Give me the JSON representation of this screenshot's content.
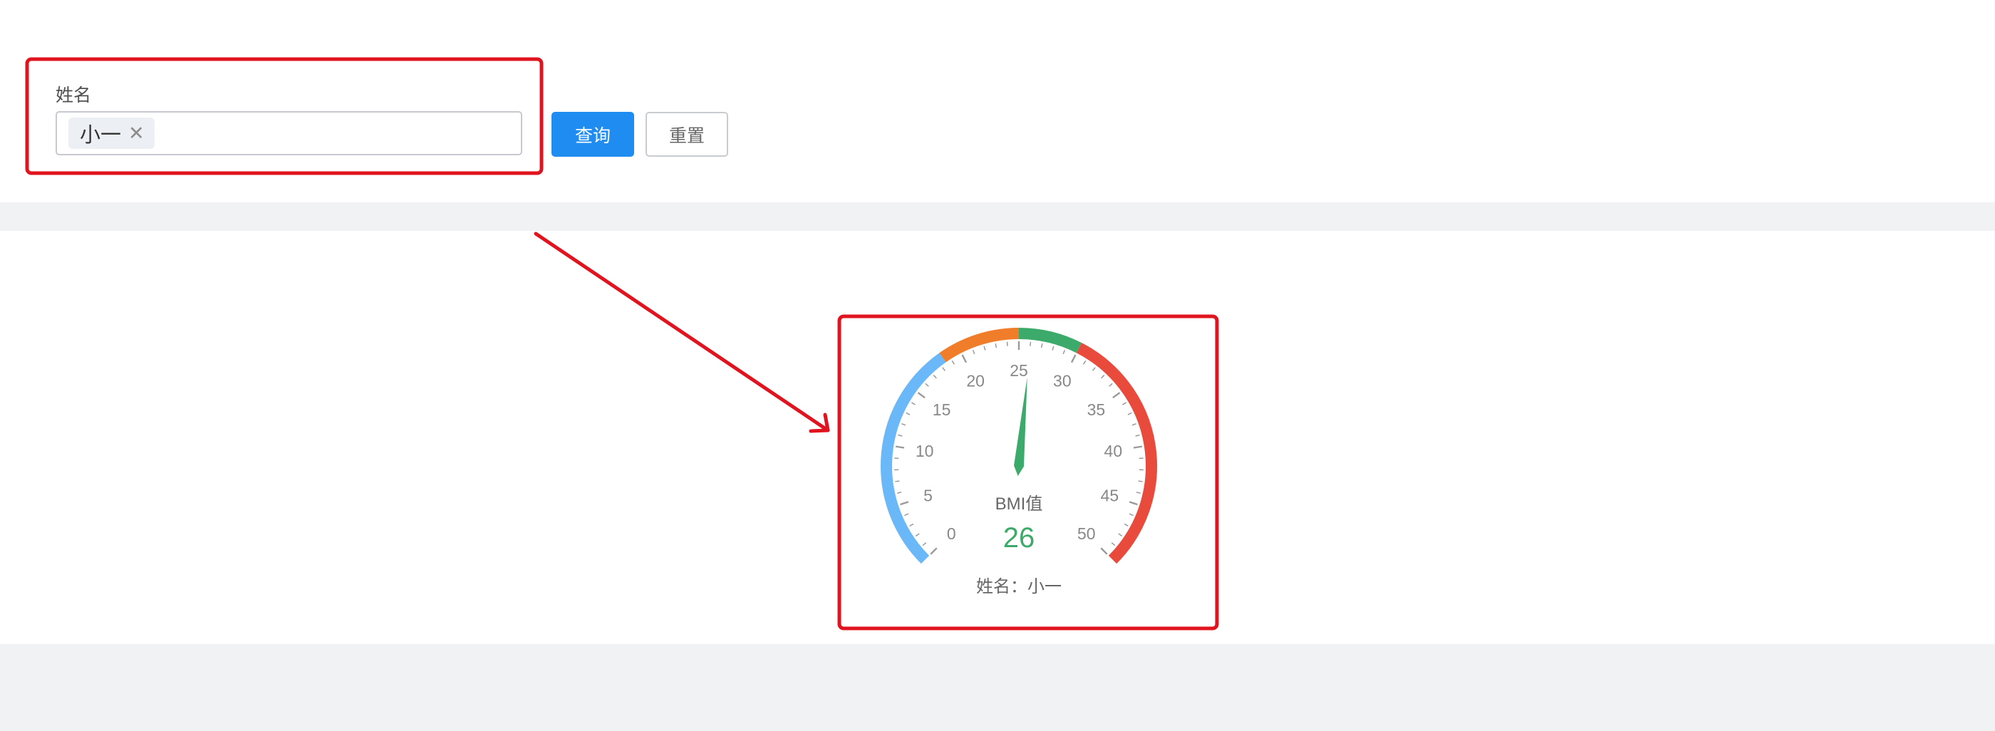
{
  "filter": {
    "label": "姓名",
    "selected_tag": "小一",
    "query_button": "查询",
    "reset_button": "重置"
  },
  "gauge": {
    "type": "gauge",
    "title": "BMI值",
    "value": 26,
    "min": 0,
    "max": 50,
    "major_ticks": [
      0,
      5,
      10,
      15,
      20,
      25,
      30,
      35,
      40,
      45,
      50
    ],
    "ranges": [
      {
        "from": 0,
        "to": 18.5,
        "color": "#6ab8f7"
      },
      {
        "from": 18.5,
        "to": 25,
        "color": "#f07d2a"
      },
      {
        "from": 25,
        "to": 30,
        "color": "#3caa6a"
      },
      {
        "from": 30,
        "to": 50,
        "color": "#e84a3c"
      }
    ],
    "value_color": "#3caa6a",
    "footer": "姓名：小一"
  },
  "annotations": {
    "highlight_color": "#e0141e"
  }
}
